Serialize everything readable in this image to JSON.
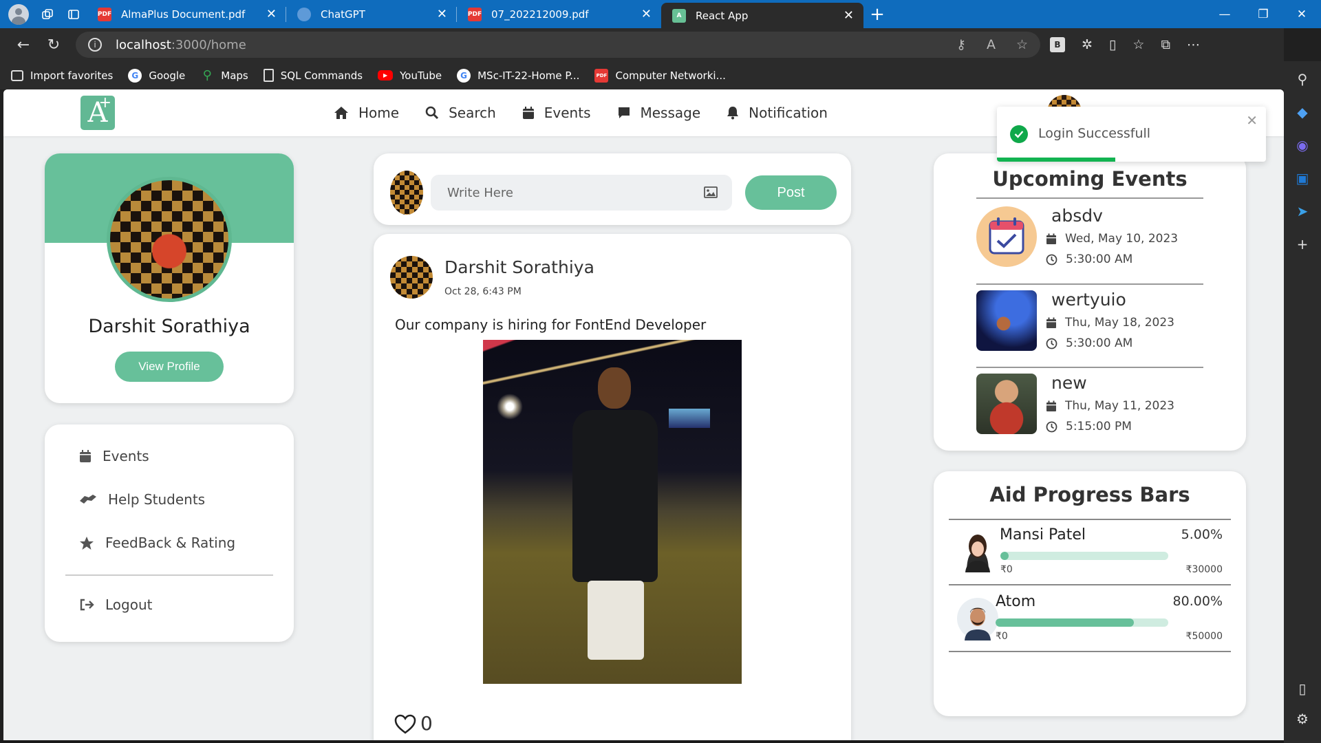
{
  "browser": {
    "tabs": [
      {
        "title": "AlmaPlus Document.pdf",
        "icon": "pdf-icon"
      },
      {
        "title": "ChatGPT",
        "icon": "chatgpt-icon"
      },
      {
        "title": "07_202212009.pdf",
        "icon": "pdf-icon"
      },
      {
        "title": "React App",
        "icon": "react-app-icon"
      }
    ],
    "url_host": "localhost",
    "url_path": ":3000/home",
    "favorites": [
      {
        "label": "Import favorites"
      },
      {
        "label": "Google"
      },
      {
        "label": "Maps"
      },
      {
        "label": "SQL Commands"
      },
      {
        "label": "YouTube"
      },
      {
        "label": "MSc-IT-22-Home P..."
      },
      {
        "label": "Computer Networki..."
      }
    ],
    "extension_label": "B"
  },
  "header": {
    "logo_text": "A",
    "logo_plus": "+",
    "nav": [
      {
        "label": "Home",
        "icon": "home-icon"
      },
      {
        "label": "Search",
        "icon": "search-icon"
      },
      {
        "label": "Events",
        "icon": "calendar-icon"
      },
      {
        "label": "Message",
        "icon": "message-icon"
      },
      {
        "label": "Notification",
        "icon": "bell-icon"
      }
    ]
  },
  "profile": {
    "name": "Darshit Sorathiya",
    "view_profile_label": "View Profile"
  },
  "sidebar_menu": [
    {
      "label": "Events",
      "icon": "calendar-icon"
    },
    {
      "label": "Help Students",
      "icon": "helping-hands-icon"
    },
    {
      "label": "FeedBack & Rating",
      "icon": "star-icon"
    },
    {
      "label": "Logout",
      "icon": "logout-icon"
    }
  ],
  "composer": {
    "placeholder": "Write Here",
    "post_label": "Post"
  },
  "post": {
    "author": "Darshit Sorathiya",
    "time": "Oct 28, 6:43 PM",
    "text": "Our company is hiring for FontEnd Developer",
    "likes": "0"
  },
  "events": {
    "title": "Upcoming Events",
    "items": [
      {
        "name": "absdv",
        "date": "Wed, May 10, 2023",
        "time": "5:30:00 AM"
      },
      {
        "name": "wertyuio",
        "date": "Thu, May 18, 2023",
        "time": "5:30:00 AM"
      },
      {
        "name": "new",
        "date": "Thu, May 11, 2023",
        "time": "5:15:00 PM"
      }
    ]
  },
  "aid": {
    "title": "Aid Progress Bars",
    "items": [
      {
        "name": "Mansi Patel",
        "percent_label": "5.00%",
        "progress": 0.05,
        "min": "₹0",
        "max": "₹30000"
      },
      {
        "name": "Atom",
        "percent_label": "80.00%",
        "progress": 0.8,
        "min": "₹0",
        "max": "₹50000"
      }
    ]
  },
  "toast": {
    "message": "Login Successfull",
    "progress": 0.44
  },
  "colors": {
    "accent": "#67c09a",
    "browser_blue": "#0f6cbd",
    "success": "#0fa84a"
  }
}
